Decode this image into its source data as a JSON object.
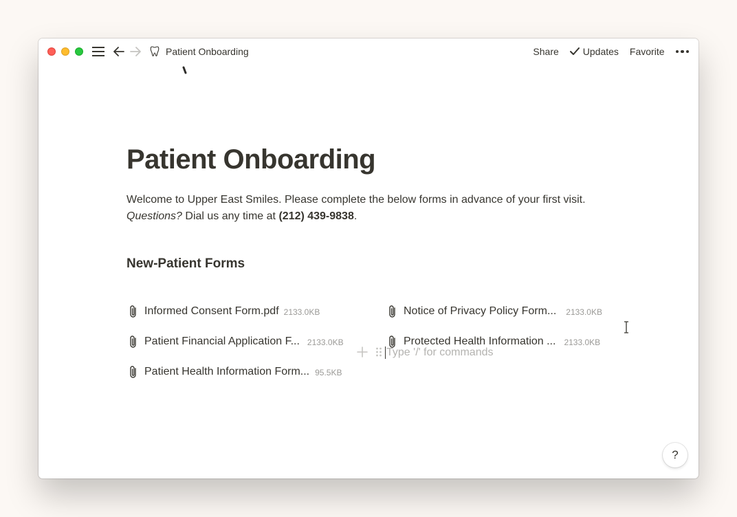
{
  "topbar": {
    "page_title": "Patient Onboarding",
    "share_label": "Share",
    "updates_label": "Updates",
    "favorite_label": "Favorite"
  },
  "page": {
    "title": "Patient Onboarding",
    "intro_part1": "Welcome to Upper East Smiles. Please complete the below forms in advance of your first visit. ",
    "intro_italic": "Questions?",
    "intro_part2": " Dial us any time at ",
    "intro_phone": "(212) 439-9838",
    "intro_end": ".",
    "section_heading": "New-Patient Forms",
    "files": [
      {
        "name": "Informed Consent Form.pdf",
        "size": "2133.0KB"
      },
      {
        "name": "Notice of Privacy Policy Form...",
        "size": "2133.0KB"
      },
      {
        "name": "Patient Financial Application F...",
        "size": "2133.0KB"
      },
      {
        "name": "Protected Health Information ...",
        "size": "2133.0KB"
      },
      {
        "name": "Patient Health Information Form...",
        "size": "95.5KB"
      }
    ],
    "placeholder": "Type '/' for commands"
  },
  "help": {
    "label": "?"
  },
  "icons": {
    "window_controls": [
      "close",
      "minimize",
      "zoom"
    ],
    "hamburger": "menu-icon",
    "back": "arrow-left-icon",
    "forward": "arrow-right-icon",
    "page": "tooth-icon",
    "updates": "checkmark-icon",
    "more": "more-horizontal-icon",
    "file": "paperclip-icon",
    "add": "plus-icon",
    "drag": "drag-handle-icon"
  }
}
